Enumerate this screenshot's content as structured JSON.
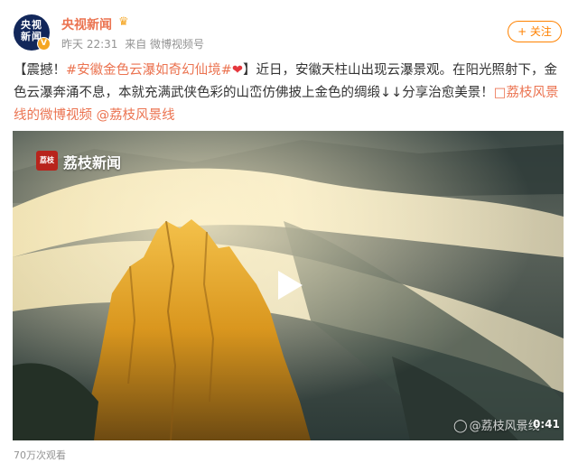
{
  "user": {
    "avatar_line1": "央视",
    "avatar_line2": "新闻",
    "verified_mark": "V",
    "name": "央视新闻",
    "crown_icon": "crown-icon"
  },
  "meta": {
    "time": "昨天 22:31",
    "source": "来自 微博视频号"
  },
  "follow_label": "+ 关注",
  "post": {
    "open_bracket": "【震撼！",
    "topic": "#安徽金色云瀑如奇幻仙境#",
    "heart": "❤",
    "body": "】近日，安徽天柱山出现云瀑景观。在阳光照射下，金色云瀑奔涌不息，本就充满武侠色彩的山峦仿佛披上金色的绸缎↓↓分享治愈美景！",
    "video_link": "荔枝风景线的微博视频",
    "mention": "@荔枝风景线"
  },
  "video": {
    "logo_badge": "荔枝",
    "logo_text": "荔枝新闻",
    "watermark": "@荔枝风景线",
    "duration": "0:41"
  },
  "views": "70万次观看",
  "colors": {
    "accent": "#eb7350",
    "follow": "#ff8200",
    "meta": "#939393"
  }
}
